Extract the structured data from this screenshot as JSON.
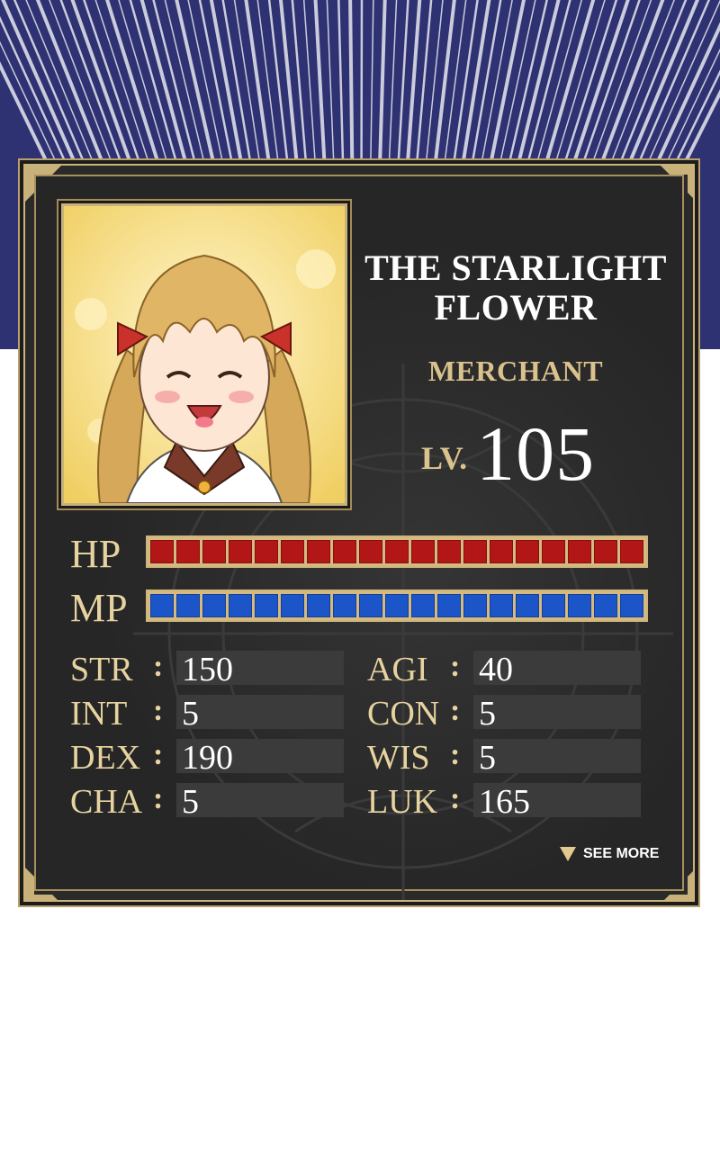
{
  "character": {
    "title_line1": "THE STARLIGHT",
    "title_line2": "FLOWER",
    "class": "MERCHANT",
    "level_label": "LV.",
    "level": "105"
  },
  "bars": {
    "hp_label": "HP",
    "mp_label": "MP",
    "hp_fill": 1.0,
    "mp_fill": 1.0,
    "hp_color": "#b31616",
    "mp_color": "#1b55c8"
  },
  "stats": [
    {
      "name": "STR",
      "value": "150"
    },
    {
      "name": "AGI",
      "value": "40"
    },
    {
      "name": "INT",
      "value": "5"
    },
    {
      "name": "CON",
      "value": "5"
    },
    {
      "name": "DEX",
      "value": "190"
    },
    {
      "name": "WIS",
      "value": "5"
    },
    {
      "name": "CHA",
      "value": "5"
    },
    {
      "name": "LUK",
      "value": "165"
    }
  ],
  "stat_separator": ":",
  "see_more_label": "SEE MORE",
  "colors": {
    "frame_gold": "#cbb37a",
    "panel_bg": "#262626",
    "speed_lines_bg": "#2b2e6e"
  }
}
